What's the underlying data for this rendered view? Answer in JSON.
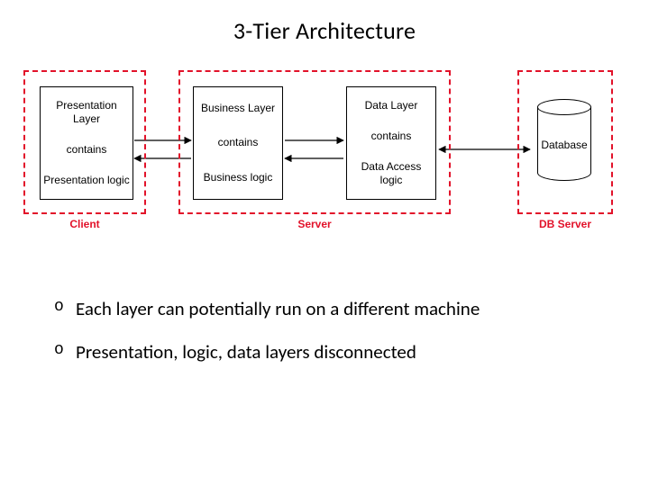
{
  "title": "3-Tier Architecture",
  "tiers": {
    "client": {
      "caption": "Client"
    },
    "server": {
      "caption": "Server"
    },
    "db": {
      "caption": "DB Server"
    }
  },
  "layers": {
    "presentation": {
      "name": "Presentation Layer",
      "rel": "contains",
      "logic": "Presentation logic"
    },
    "business": {
      "name": "Business Layer",
      "rel": "contains",
      "logic": "Business logic"
    },
    "data": {
      "name": "Data Layer",
      "rel": "contains",
      "logic": "Data Access logic"
    }
  },
  "database": {
    "label": "Database"
  },
  "bullets": [
    "Each layer can potentially run on a different machine",
    "Presentation, logic, data layers disconnected"
  ]
}
